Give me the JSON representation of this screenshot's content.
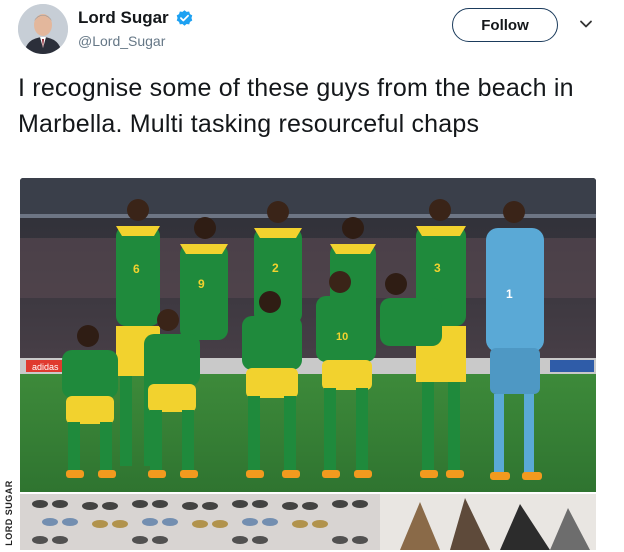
{
  "tweet": {
    "author_name": "Lord Sugar",
    "author_handle": "@Lord_Sugar",
    "follow_label": "Follow",
    "text": "I recognise some of these guys from the beach in Marbella. Multi tasking resourceful chaps"
  },
  "photo": {
    "jersey_numbers": [
      "6",
      "9",
      "2",
      "3",
      "1",
      "10"
    ],
    "board_text": "adidas"
  },
  "watermark": "LORD SUGAR",
  "colors": {
    "verified_blue": "#1da1f2",
    "kit_green": "#1f8a3c",
    "kit_yellow": "#f2d22e",
    "keeper_blue": "#5aa9d6"
  }
}
